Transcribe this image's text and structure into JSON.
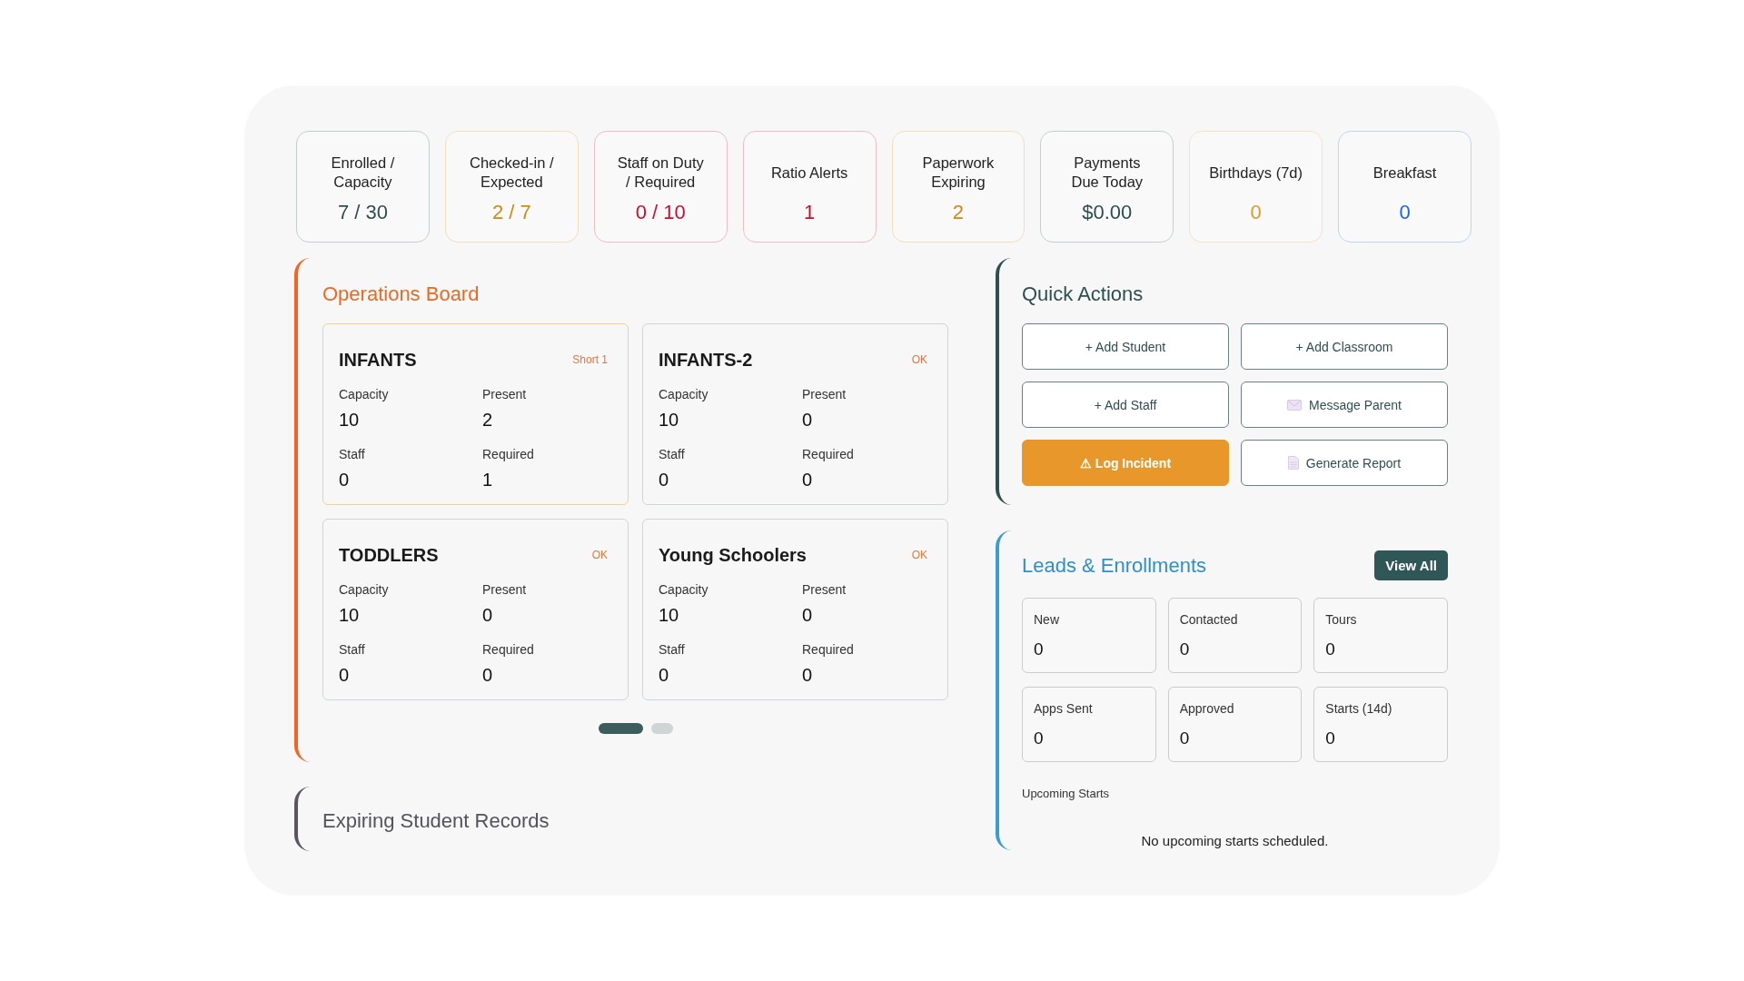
{
  "kpis": [
    {
      "label": "Enrolled /\nCapacity",
      "value": "7 / 30",
      "color": "#2f4f4f"
    },
    {
      "label": "Checked-in /\nExpected",
      "value": "2 / 7",
      "color": "#d4890f"
    },
    {
      "label": "Staff on Duty\n/ Required",
      "value": "0 / 10",
      "color": "#c8102e"
    },
    {
      "label": "Ratio Alerts",
      "value": "1",
      "color": "#c8102e"
    },
    {
      "label": "Paperwork\nExpiring",
      "value": "2",
      "color": "#d4890f"
    },
    {
      "label": "Payments\nDue Today",
      "value": "$0.00",
      "color": "#2f4f4f"
    },
    {
      "label": "Birthdays (7d)",
      "value": "0",
      "color": "#e39a2c"
    },
    {
      "label": "Breakfast",
      "value": "0",
      "color": "#1a66e6"
    }
  ],
  "operations_board": {
    "title": "Operations Board",
    "classrooms": [
      {
        "name": "INFANTS",
        "status": "Short 1",
        "alert": true,
        "stats": [
          {
            "label": "Capacity",
            "value": "10"
          },
          {
            "label": "Present",
            "value": "2"
          },
          {
            "label": "Staff",
            "value": "0"
          },
          {
            "label": "Required",
            "value": "1"
          }
        ]
      },
      {
        "name": "INFANTS-2",
        "status": "OK",
        "alert": false,
        "stats": [
          {
            "label": "Capacity",
            "value": "10"
          },
          {
            "label": "Present",
            "value": "0"
          },
          {
            "label": "Staff",
            "value": "0"
          },
          {
            "label": "Required",
            "value": "0"
          }
        ]
      },
      {
        "name": "TODDLERS",
        "status": "OK",
        "alert": false,
        "stats": [
          {
            "label": "Capacity",
            "value": "10"
          },
          {
            "label": "Present",
            "value": "0"
          },
          {
            "label": "Staff",
            "value": "0"
          },
          {
            "label": "Required",
            "value": "0"
          }
        ]
      },
      {
        "name": "Young Schoolers",
        "status": "OK",
        "alert": false,
        "stats": [
          {
            "label": "Capacity",
            "value": "10"
          },
          {
            "label": "Present",
            "value": "0"
          },
          {
            "label": "Staff",
            "value": "0"
          },
          {
            "label": "Required",
            "value": "0"
          }
        ]
      }
    ],
    "pages": [
      {
        "selected": true
      },
      {
        "selected": false
      }
    ]
  },
  "expiring_records": {
    "title": "Expiring Student Records"
  },
  "quick_actions": {
    "title": "Quick Actions",
    "actions": [
      {
        "label": "+ Add Student",
        "kind": "add"
      },
      {
        "label": "+ Add Classroom",
        "kind": "add"
      },
      {
        "label": "+ Add Staff",
        "kind": "add"
      },
      {
        "label": "Message Parent",
        "kind": "message"
      },
      {
        "label": "⚠ Log Incident",
        "kind": "incident"
      },
      {
        "label": "Generate Report",
        "kind": "report"
      }
    ]
  },
  "leads": {
    "title": "Leads & Enrollments",
    "view_all": "View All",
    "stats": [
      {
        "label": "New",
        "value": "0"
      },
      {
        "label": "Contacted",
        "value": "0"
      },
      {
        "label": "Tours",
        "value": "0"
      },
      {
        "label": "Apps Sent",
        "value": "0"
      },
      {
        "label": "Approved",
        "value": "0"
      },
      {
        "label": "Starts (14d)",
        "value": "0"
      }
    ],
    "upcoming": {
      "title": "Upcoming Starts",
      "empty_message": "No upcoming starts scheduled."
    }
  }
}
